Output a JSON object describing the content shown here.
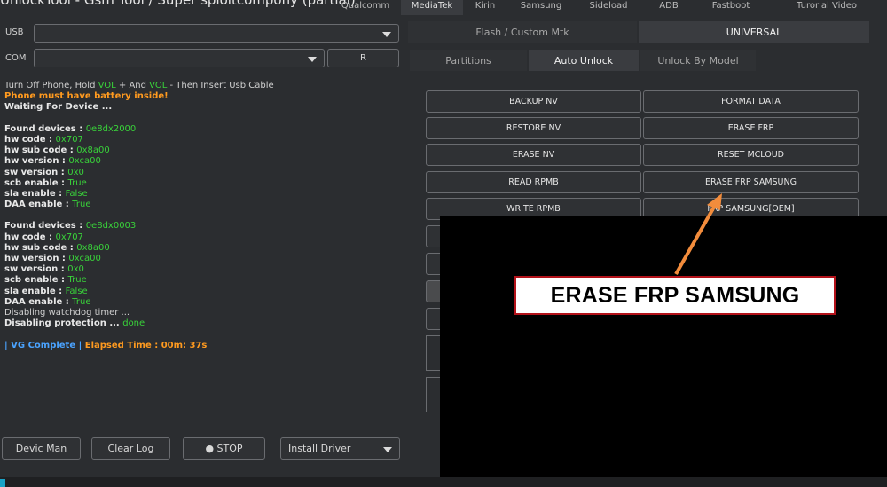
{
  "header": {
    "title": "UnlockTool - Gsm Tool / Super sploitcompony (partial)",
    "tabs": [
      {
        "label": "Qualcomm",
        "active": false
      },
      {
        "label": "MediaTek",
        "active": true
      },
      {
        "label": "Kirin",
        "active": false
      },
      {
        "label": "Samsung",
        "active": false
      },
      {
        "label": "Sideload",
        "active": false
      },
      {
        "label": "ADB",
        "active": false
      },
      {
        "label": "Fastboot",
        "active": false
      },
      {
        "label": "Turorial Video",
        "active": false
      }
    ]
  },
  "connection": {
    "usb_label": "USB",
    "com_label": "COM",
    "refresh_label": "R"
  },
  "log": {
    "lines": [
      {
        "parts": [
          {
            "t": "Turn Off Phone, Hold ",
            "c": "n"
          },
          {
            "t": "VOL",
            "c": "g"
          },
          {
            "t": " + And ",
            "c": "n"
          },
          {
            "t": "VOL",
            "c": "g"
          },
          {
            "t": " - Then Insert Usb Cable",
            "c": "n"
          }
        ]
      },
      {
        "parts": [
          {
            "t": "Phone must have battery inside!",
            "c": "o"
          }
        ]
      },
      {
        "parts": [
          {
            "t": "Waiting For Device ...",
            "c": "w"
          }
        ]
      },
      {
        "gap": true
      },
      {
        "parts": [
          {
            "t": "Found devices : ",
            "c": "w"
          },
          {
            "t": "0e8dx2000",
            "c": "g"
          }
        ]
      },
      {
        "parts": [
          {
            "t": "hw code : ",
            "c": "w"
          },
          {
            "t": "0x707",
            "c": "g"
          }
        ]
      },
      {
        "parts": [
          {
            "t": "hw sub code : ",
            "c": "w"
          },
          {
            "t": "0x8a00",
            "c": "g"
          }
        ]
      },
      {
        "parts": [
          {
            "t": "hw version : ",
            "c": "w"
          },
          {
            "t": "0xca00",
            "c": "g"
          }
        ]
      },
      {
        "parts": [
          {
            "t": "sw version : ",
            "c": "w"
          },
          {
            "t": "0x0",
            "c": "g"
          }
        ]
      },
      {
        "parts": [
          {
            "t": "scb enable : ",
            "c": "w"
          },
          {
            "t": "True",
            "c": "g"
          }
        ]
      },
      {
        "parts": [
          {
            "t": "sla enable : ",
            "c": "w"
          },
          {
            "t": "False",
            "c": "g"
          }
        ]
      },
      {
        "parts": [
          {
            "t": "DAA enable : ",
            "c": "w"
          },
          {
            "t": "True",
            "c": "g"
          }
        ]
      },
      {
        "gap": true
      },
      {
        "parts": [
          {
            "t": "Found devices : ",
            "c": "w"
          },
          {
            "t": "0e8dx0003",
            "c": "g"
          }
        ]
      },
      {
        "parts": [
          {
            "t": "hw code : ",
            "c": "w"
          },
          {
            "t": "0x707",
            "c": "g"
          }
        ]
      },
      {
        "parts": [
          {
            "t": "hw sub code : ",
            "c": "w"
          },
          {
            "t": "0x8a00",
            "c": "g"
          }
        ]
      },
      {
        "parts": [
          {
            "t": "hw version : ",
            "c": "w"
          },
          {
            "t": "0xca00",
            "c": "g"
          }
        ]
      },
      {
        "parts": [
          {
            "t": "sw version : ",
            "c": "w"
          },
          {
            "t": "0x0",
            "c": "g"
          }
        ]
      },
      {
        "parts": [
          {
            "t": "scb enable : ",
            "c": "w"
          },
          {
            "t": "True",
            "c": "g"
          }
        ]
      },
      {
        "parts": [
          {
            "t": "sla enable : ",
            "c": "w"
          },
          {
            "t": "False",
            "c": "g"
          }
        ]
      },
      {
        "parts": [
          {
            "t": "DAA enable : ",
            "c": "w"
          },
          {
            "t": "True",
            "c": "g"
          }
        ]
      },
      {
        "parts": [
          {
            "t": "Disabling watchdog timer ...",
            "c": "n"
          }
        ]
      },
      {
        "parts": [
          {
            "t": "Disabling protection ... ",
            "c": "w"
          },
          {
            "t": "done",
            "c": "g"
          }
        ]
      },
      {
        "gap": true
      },
      {
        "parts": [
          {
            "t": "| VG Complete |",
            "c": "b"
          },
          {
            "t": "   Elapsed Time : 00m: 37s",
            "c": "o"
          }
        ]
      }
    ]
  },
  "bottom_buttons": {
    "device_manager": "Devic Man",
    "clear_log": "Clear Log",
    "stop": "● STOP",
    "install_driver": "Install Driver"
  },
  "mode_tabs": {
    "flash": "Flash / Custom Mtk",
    "universal": "UNIVERSAL"
  },
  "sub_tabs": {
    "partitions": "Partitions",
    "auto_unlock": "Auto Unlock",
    "unlock_by_model": "Unlock By Model"
  },
  "actions": {
    "backup_nv": "BACKUP NV",
    "format_data": "FORMAT DATA",
    "restore_nv": "RESTORE NV",
    "erase_frp": "ERASE FRP",
    "erase_nv": "ERASE NV",
    "reset_mcloud": "RESET MCLOUD",
    "read_rpmb": "READ RPMB",
    "erase_frp_samsung": "ERASE FRP SAMSUNG",
    "write_rpmb": "WRITE RPMB",
    "frp_samsung_oem": "FRP SAMSUNG[OEM]"
  },
  "annotation": {
    "callout_text": "ERASE FRP SAMSUNG",
    "arrow_color": "#f28c3c",
    "border_color": "#b3121a"
  }
}
